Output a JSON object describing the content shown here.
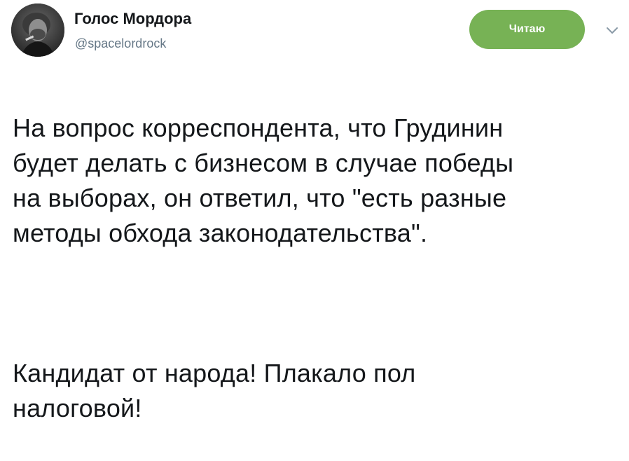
{
  "user": {
    "display_name": "Голос Мордора",
    "handle": "@spacelordrock",
    "avatar_icon": "user-avatar-photo"
  },
  "actions": {
    "follow_label": "Читаю",
    "follow_color": "#77b255",
    "menu_icon": "chevron-down-icon"
  },
  "tweet": {
    "paragraphs": [
      "На вопрос корреспондента, что Грудинин\nбудет делать с бизнесом в случае победы\nна выборах, он ответил, что \"есть разные\nметоды обхода законодательства\".",
      "Кандидат от народа! Плакало пол\nналоговой!"
    ]
  }
}
